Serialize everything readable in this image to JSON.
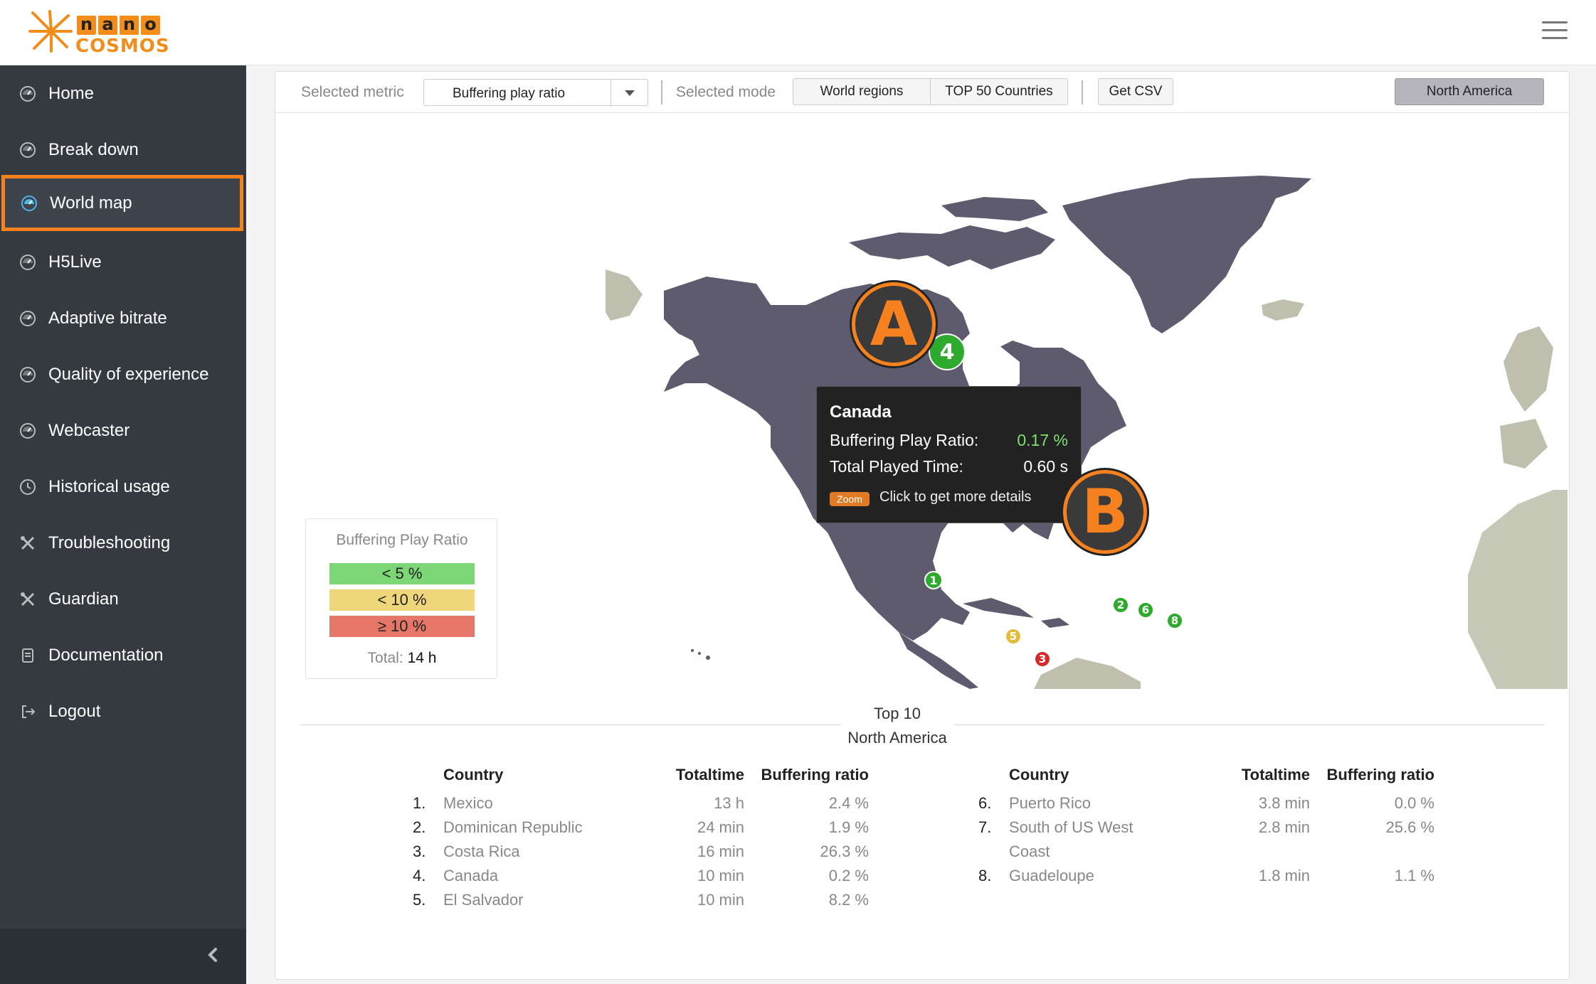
{
  "header": {
    "logo_letters": [
      "n",
      "a",
      "n",
      "o"
    ],
    "logo_sub": "COSMOS",
    "menu_icon": "hamburger-icon"
  },
  "sidebar": {
    "items": [
      {
        "label": "Home",
        "icon": "dashboard-icon"
      },
      {
        "label": "Break down",
        "icon": "dashboard-icon"
      },
      {
        "label": "World map",
        "icon": "dashboard-icon",
        "active": true
      },
      {
        "label": "H5Live",
        "icon": "dashboard-icon"
      },
      {
        "label": "Adaptive bitrate",
        "icon": "dashboard-icon"
      },
      {
        "label": "Quality of experience",
        "icon": "dashboard-icon"
      },
      {
        "label": "Webcaster",
        "icon": "dashboard-icon"
      },
      {
        "label": "Historical usage",
        "icon": "clock-icon"
      },
      {
        "label": "Troubleshooting",
        "icon": "tools-icon"
      },
      {
        "label": "Guardian",
        "icon": "tools-icon"
      },
      {
        "label": "Documentation",
        "icon": "document-icon"
      },
      {
        "label": "Logout",
        "icon": "logout-icon"
      }
    ],
    "collapse_icon": "chevron-left-icon"
  },
  "toolbar": {
    "metric_label": "Selected metric",
    "metric_value": "Buffering play ratio",
    "mode_label": "Selected mode",
    "mode_world": "World regions",
    "mode_top50": "TOP 50 Countries",
    "csv_button": "Get CSV",
    "region_button": "North America"
  },
  "legend": {
    "title": "Buffering Play Ratio",
    "rows": [
      {
        "label": "< 5 %",
        "color": "#7dd676"
      },
      {
        "label": "< 10 %",
        "color": "#f0d67a"
      },
      {
        "label": "≥ 10 %",
        "color": "#e67667"
      }
    ],
    "total_label": "Total:",
    "total_value": "14 h"
  },
  "tooltip": {
    "country": "Canada",
    "ratio_label": "Buffering Play Ratio:",
    "ratio_value": "0.17 %",
    "time_label": "Total Played Time:",
    "time_value": "0.60 s",
    "zoom_badge": "Zoom",
    "hint": "Click to get more details"
  },
  "annotations": {
    "a": "A",
    "b": "B"
  },
  "map_markers": [
    {
      "rank": "4",
      "color": "#2eab2e"
    },
    {
      "rank": "1",
      "color": "#2eab2e"
    },
    {
      "rank": "2",
      "color": "#2eab2e"
    },
    {
      "rank": "6",
      "color": "#2eab2e"
    },
    {
      "rank": "8",
      "color": "#2eab2e"
    },
    {
      "rank": "5",
      "color": "#e2bc3b"
    },
    {
      "rank": "3",
      "color": "#d42a2a"
    }
  ],
  "top10": {
    "title_line1": "Top 10",
    "title_line2": "North America",
    "headers": {
      "country": "Country",
      "totaltime": "Totaltime",
      "ratio": "Buffering ratio"
    },
    "left": [
      {
        "n": "1.",
        "country": "Mexico",
        "time": "13 h",
        "ratio": "2.4 %"
      },
      {
        "n": "2.",
        "country": "Dominican Republic",
        "time": "24 min",
        "ratio": "1.9 %"
      },
      {
        "n": "3.",
        "country": "Costa Rica",
        "time": "16 min",
        "ratio": "26.3 %"
      },
      {
        "n": "4.",
        "country": "Canada",
        "time": "10 min",
        "ratio": "0.2 %"
      },
      {
        "n": "5.",
        "country": "El Salvador",
        "time": "10 min",
        "ratio": "8.2 %"
      }
    ],
    "right": [
      {
        "n": "6.",
        "country": "Puerto Rico",
        "time": "3.8 min",
        "ratio": "0.0 %"
      },
      {
        "n": "7.",
        "country": "South of US West",
        "country_line2": "Coast",
        "time": "2.8 min",
        "ratio": "25.6 %"
      },
      {
        "n": "8.",
        "country": "Guadeloupe",
        "time": "1.8 min",
        "ratio": "1.1 %"
      }
    ]
  }
}
